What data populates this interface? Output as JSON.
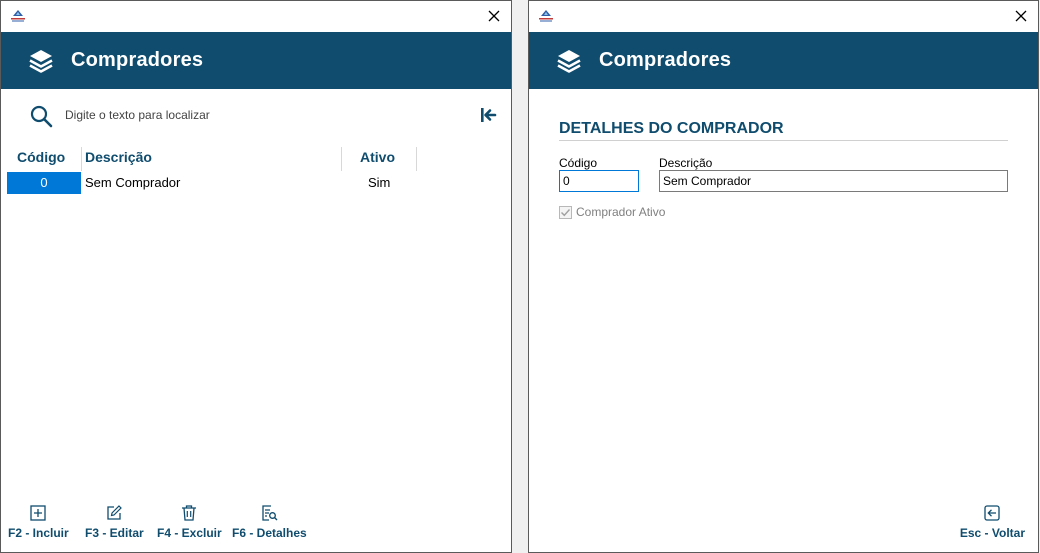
{
  "colors": {
    "brand": "#0f4c6e",
    "selection": "#0078d7"
  },
  "left_window": {
    "title": "Compradores",
    "search": {
      "placeholder": "Digite o texto para localizar",
      "value": ""
    },
    "table": {
      "columns": [
        "Código",
        "Descrição",
        "Ativo"
      ],
      "rows": [
        {
          "codigo": "0",
          "descricao": "Sem Comprador",
          "ativo": "Sim"
        }
      ]
    },
    "footer": {
      "incluir": "F2 - Incluir",
      "editar": "F3 - Editar",
      "excluir": "F4 - Excluir",
      "detalhes": "F6 - Detalhes"
    }
  },
  "right_window": {
    "title": "Compradores",
    "section_title": "DETALHES DO COMPRADOR",
    "codigo_label": "Código",
    "codigo_value": "0",
    "descricao_label": "Descrição",
    "descricao_value": "Sem Comprador",
    "ativo_label": "Comprador Ativo",
    "ativo_checked": true,
    "back_label": "Esc - Voltar"
  }
}
